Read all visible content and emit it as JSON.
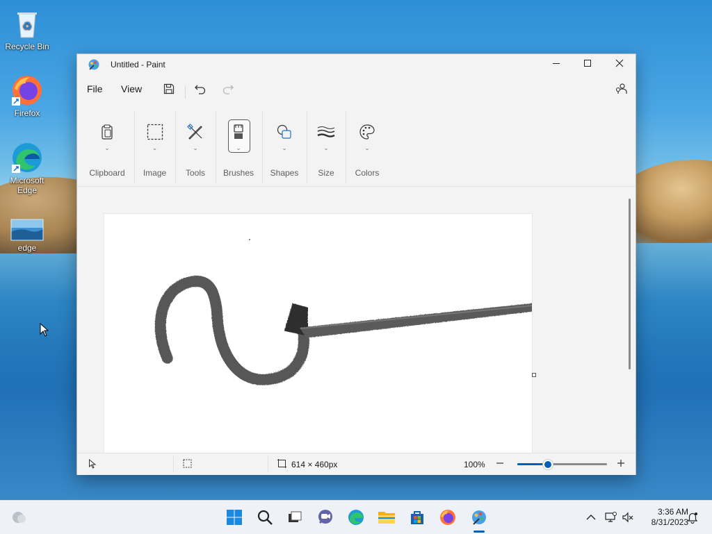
{
  "desktop": {
    "icons": [
      {
        "label": "Recycle Bin",
        "icon": "recycle-bin-icon"
      },
      {
        "label": "Firefox",
        "icon": "firefox-icon"
      },
      {
        "label": "Microsoft Edge",
        "icon": "edge-icon"
      },
      {
        "label": "edge",
        "icon": "image-file-icon"
      }
    ]
  },
  "window": {
    "title": "Untitled - Paint",
    "app_icon": "paint-icon",
    "controls": [
      "minimize-icon",
      "maximize-icon",
      "close-icon"
    ]
  },
  "menubar": {
    "file_label": "File",
    "view_label": "View",
    "icons": [
      "save-icon",
      "undo-icon",
      "redo-icon",
      "account-settings-icon"
    ]
  },
  "ribbon": {
    "groups": [
      {
        "label": "Clipboard",
        "icon": "clipboard-icon"
      },
      {
        "label": "Image",
        "icon": "select-icon"
      },
      {
        "label": "Tools",
        "icon": "tools-icon"
      },
      {
        "label": "Brushes",
        "icon": "brush-icon",
        "selected": true
      },
      {
        "label": "Shapes",
        "icon": "shapes-icon"
      },
      {
        "label": "Size",
        "icon": "size-icon"
      },
      {
        "label": "Colors",
        "icon": "palette-icon"
      }
    ]
  },
  "statusbar": {
    "canvas_size": "614 × 460px",
    "zoom": "100%",
    "zoom_fraction": 0.33
  },
  "taskbar": {
    "icons": [
      "weather-icon",
      "start-icon",
      "search-icon",
      "task-view-icon",
      "chat-icon",
      "edge-icon",
      "file-explorer-icon",
      "store-icon",
      "firefox-icon",
      "paint-icon"
    ],
    "active": "paint-icon",
    "tray_icons": [
      "chevron-up-icon",
      "network-icon",
      "volume-muted-icon",
      "notification-icon"
    ],
    "time": "3:36 AM",
    "date": "8/31/2023"
  },
  "colors": {
    "accent": "#005fb8",
    "canvas": "#ffffff",
    "stroke": "#3a3a3a"
  }
}
